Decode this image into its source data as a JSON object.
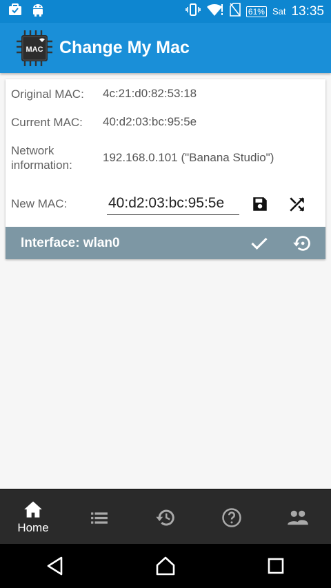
{
  "statusbar": {
    "battery": "61%",
    "day": "Sat",
    "time": "13:35"
  },
  "app": {
    "title": "Change My Mac",
    "logo_text": "MAC"
  },
  "info": {
    "original_label": "Original MAC:",
    "original_value": "4c:21:d0:82:53:18",
    "current_label": "Current MAC:",
    "current_value": "40:d2:03:bc:95:5e",
    "network_label": "Network information:",
    "network_value": "192.168.0.101 (\"Banana Studio\")",
    "new_label": "New MAC:",
    "new_value": "40:d2:03:bc:95:5e"
  },
  "interface": {
    "label": "Interface: wlan0"
  },
  "bottom_nav": {
    "home_label": "Home"
  },
  "colors": {
    "statusbar": "#0e86d0",
    "appbar": "#1a8fd8",
    "interface_bar": "#7d97a4",
    "bottom_nav": "#2a2a2a"
  }
}
